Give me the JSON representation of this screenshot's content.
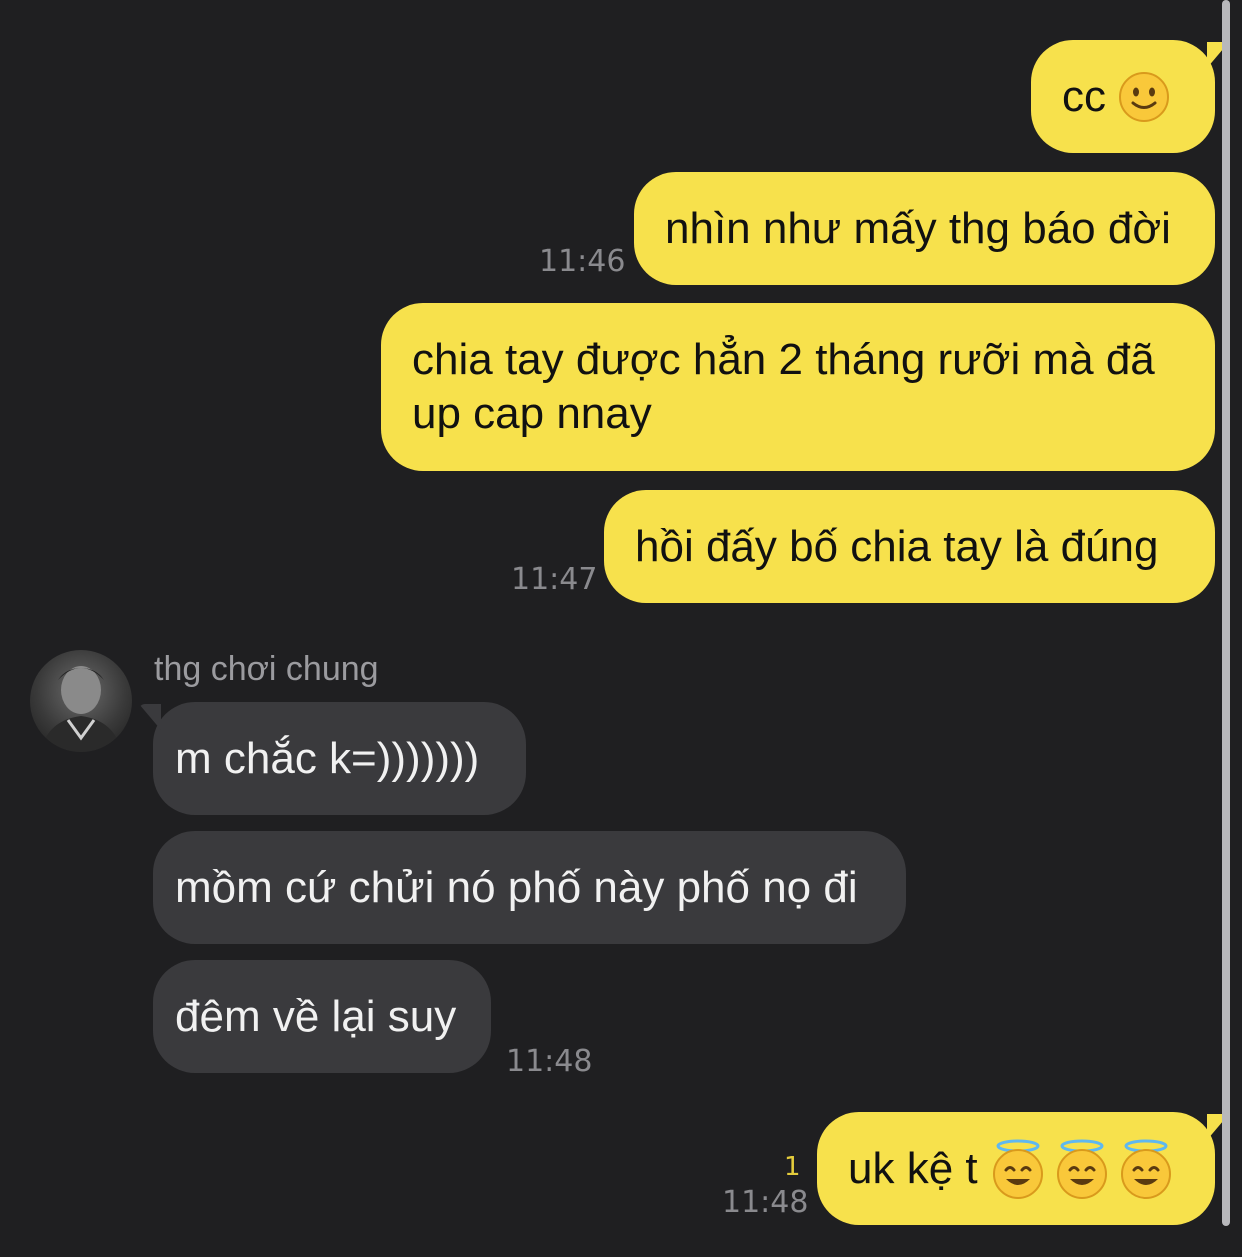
{
  "conversation": {
    "contact_name": "thg chơi chung",
    "messages": [
      {
        "id": "m1",
        "direction": "out",
        "text": "cc",
        "emoji": [
          "slightly-smiling-face"
        ]
      },
      {
        "id": "m2",
        "direction": "out",
        "text": "nhìn như mấy thg báo đời",
        "time": "11:46"
      },
      {
        "id": "m3",
        "direction": "out",
        "lines": [
          "chia tay được hẳn 2 tháng rưỡi mà đã",
          "up cap nnay"
        ]
      },
      {
        "id": "m4",
        "direction": "out",
        "text": "hồi đấy bố chia tay là đúng",
        "time": "11:47"
      },
      {
        "id": "m5",
        "direction": "in",
        "text": "m chắc k=)))))))"
      },
      {
        "id": "m6",
        "direction": "in",
        "text": "mồm cứ chửi nó phố này phố nọ đi"
      },
      {
        "id": "m7",
        "direction": "in",
        "text": "đêm về lại suy",
        "time": "11:48"
      },
      {
        "id": "m8",
        "direction": "out",
        "text": "uk kệ t",
        "emoji": [
          "smiling-face-with-halo",
          "smiling-face-with-halo",
          "smiling-face-with-halo"
        ],
        "time": "11:48",
        "unread_count": "1"
      }
    ]
  },
  "colors": {
    "background": "#1f1f21",
    "outgoing_bubble": "#f7e14c",
    "incoming_bubble": "#3a3a3d",
    "timestamp": "#8a8a8e",
    "unread_count": "#e4cc3c"
  }
}
